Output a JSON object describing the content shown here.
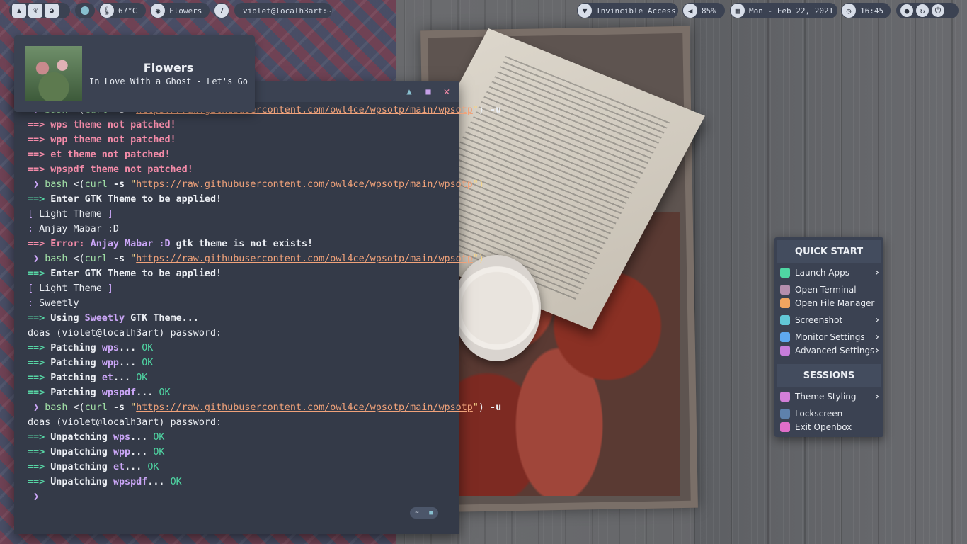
{
  "topbar": {
    "temperature": "67°C",
    "song": "Flowers",
    "workspace": "7",
    "terminal_title": "violet@localh3art:~",
    "network": "Invincible Access",
    "volume": "85%",
    "date": "Mon - Feb 22, 2021",
    "time": "16:45"
  },
  "music": {
    "title": "Flowers",
    "artist": "In Love With a Ghost - Let's Go"
  },
  "terminal": {
    "lines": [
      [
        {
          "t": " ❯ ",
          "c": "vi b"
        },
        {
          "t": "bash ",
          "c": "g"
        },
        {
          "t": "<(",
          "c": ""
        },
        {
          "t": "curl",
          "c": "g"
        },
        {
          "t": " -s ",
          "c": "b"
        },
        {
          "t": "\"",
          "c": "yel"
        },
        {
          "t": "https://raw.githubusercontent.com/owl4ce/wpsotp/main/wpsotp",
          "c": "url"
        },
        {
          "t": "\"",
          "c": "yel"
        },
        {
          "t": ") ",
          "c": ""
        },
        {
          "t": "-u",
          "c": "b"
        }
      ],
      [
        {
          "t": "==> ",
          "c": "pk b"
        },
        {
          "t": "wps theme not patched!",
          "c": "pk b"
        }
      ],
      [
        {
          "t": "==> ",
          "c": "pk b"
        },
        {
          "t": "wpp theme not patched!",
          "c": "pk b"
        }
      ],
      [
        {
          "t": "==> ",
          "c": "pk b"
        },
        {
          "t": "et theme not patched!",
          "c": "pk b"
        }
      ],
      [
        {
          "t": "==> ",
          "c": "pk b"
        },
        {
          "t": "wpspdf theme not patched!",
          "c": "pk b"
        }
      ],
      [
        {
          "t": " ❯ ",
          "c": "vi b"
        },
        {
          "t": "bash ",
          "c": "g"
        },
        {
          "t": "<(",
          "c": ""
        },
        {
          "t": "curl",
          "c": "g"
        },
        {
          "t": " -s ",
          "c": "b"
        },
        {
          "t": "\"",
          "c": "yel"
        },
        {
          "t": "https://raw.githubusercontent.com/owl4ce/wpsotp/main/wpsotp",
          "c": "url"
        },
        {
          "t": "\")",
          "c": "yel"
        }
      ],
      [
        {
          "t": "==> ",
          "c": "gb b"
        },
        {
          "t": "Enter GTK Theme to be applied!",
          "c": "b"
        }
      ],
      [
        {
          "t": "[ ",
          "c": "vi"
        },
        {
          "t": "Light Theme",
          "c": ""
        },
        {
          "t": " ]",
          "c": "vi"
        }
      ],
      [
        {
          "t": ": ",
          "c": "vi"
        },
        {
          "t": "Anjay Mabar :D",
          "c": ""
        }
      ],
      [
        {
          "t": "==> ",
          "c": "pk b"
        },
        {
          "t": "Error: ",
          "c": "pk b"
        },
        {
          "t": "Anjay Mabar :D ",
          "c": "vi b"
        },
        {
          "t": "gtk theme is not exists!",
          "c": "b"
        }
      ],
      [
        {
          "t": " ❯ ",
          "c": "vi b"
        },
        {
          "t": "bash ",
          "c": "g"
        },
        {
          "t": "<(",
          "c": ""
        },
        {
          "t": "curl",
          "c": "g"
        },
        {
          "t": " -s ",
          "c": "b"
        },
        {
          "t": "\"",
          "c": "yel"
        },
        {
          "t": "https://raw.githubusercontent.com/owl4ce/wpsotp/main/wpsotp",
          "c": "url"
        },
        {
          "t": "\")",
          "c": "yel"
        }
      ],
      [
        {
          "t": "==> ",
          "c": "gb b"
        },
        {
          "t": "Enter GTK Theme to be applied!",
          "c": "b"
        }
      ],
      [
        {
          "t": "[ ",
          "c": "vi"
        },
        {
          "t": "Light Theme",
          "c": ""
        },
        {
          "t": " ]",
          "c": "vi"
        }
      ],
      [
        {
          "t": ": ",
          "c": "vi"
        },
        {
          "t": "Sweetly",
          "c": ""
        }
      ],
      [
        {
          "t": "==> ",
          "c": "gb b"
        },
        {
          "t": "Using ",
          "c": "b"
        },
        {
          "t": "Sweetly ",
          "c": "vi b"
        },
        {
          "t": "GTK Theme...",
          "c": "b"
        }
      ],
      [
        {
          "t": "doas (violet@localh3art) password:",
          "c": ""
        }
      ],
      [
        {
          "t": "==> ",
          "c": "gb b"
        },
        {
          "t": "Patching ",
          "c": "b"
        },
        {
          "t": "wps",
          "c": "vi b"
        },
        {
          "t": "... ",
          "c": "b"
        },
        {
          "t": "OK",
          "c": "ok"
        }
      ],
      [
        {
          "t": "==> ",
          "c": "gb b"
        },
        {
          "t": "Patching ",
          "c": "b"
        },
        {
          "t": "wpp",
          "c": "vi b"
        },
        {
          "t": "... ",
          "c": "b"
        },
        {
          "t": "OK",
          "c": "ok"
        }
      ],
      [
        {
          "t": "==> ",
          "c": "gb b"
        },
        {
          "t": "Patching ",
          "c": "b"
        },
        {
          "t": "et",
          "c": "vi b"
        },
        {
          "t": "... ",
          "c": "b"
        },
        {
          "t": "OK",
          "c": "ok"
        }
      ],
      [
        {
          "t": "==> ",
          "c": "gb b"
        },
        {
          "t": "Patching ",
          "c": "b"
        },
        {
          "t": "wpspdf",
          "c": "vi b"
        },
        {
          "t": "... ",
          "c": "b"
        },
        {
          "t": "OK",
          "c": "ok"
        }
      ],
      [
        {
          "t": " ❯ ",
          "c": "vi b"
        },
        {
          "t": "bash ",
          "c": "g"
        },
        {
          "t": "<(",
          "c": ""
        },
        {
          "t": "curl",
          "c": "g"
        },
        {
          "t": " -s ",
          "c": "b"
        },
        {
          "t": "\"",
          "c": "yel"
        },
        {
          "t": "https://raw.githubusercontent.com/owl4ce/wpsotp/main/wpsotp",
          "c": "url"
        },
        {
          "t": "\"",
          "c": "yel"
        },
        {
          "t": ") ",
          "c": ""
        },
        {
          "t": "-u",
          "c": "b"
        }
      ],
      [
        {
          "t": "doas (violet@localh3art) password:",
          "c": ""
        }
      ],
      [
        {
          "t": "==> ",
          "c": "gb b"
        },
        {
          "t": "Unpatching ",
          "c": "b"
        },
        {
          "t": "wps",
          "c": "vi b"
        },
        {
          "t": "... ",
          "c": "b"
        },
        {
          "t": "OK",
          "c": "ok"
        }
      ],
      [
        {
          "t": "==> ",
          "c": "gb b"
        },
        {
          "t": "Unpatching ",
          "c": "b"
        },
        {
          "t": "wpp",
          "c": "vi b"
        },
        {
          "t": "... ",
          "c": "b"
        },
        {
          "t": "OK",
          "c": "ok"
        }
      ],
      [
        {
          "t": "==> ",
          "c": "gb b"
        },
        {
          "t": "Unpatching ",
          "c": "b"
        },
        {
          "t": "et",
          "c": "vi b"
        },
        {
          "t": "... ",
          "c": "b"
        },
        {
          "t": "OK",
          "c": "ok"
        }
      ],
      [
        {
          "t": "==> ",
          "c": "gb b"
        },
        {
          "t": "Unpatching ",
          "c": "b"
        },
        {
          "t": "wpspdf",
          "c": "vi b"
        },
        {
          "t": "... ",
          "c": "b"
        },
        {
          "t": "OK",
          "c": "ok"
        }
      ],
      [
        {
          "t": " ❯",
          "c": "vi b"
        }
      ]
    ],
    "chips": [
      "~",
      "■"
    ]
  },
  "menu": {
    "quick_start": "QUICK START",
    "items": [
      {
        "label": "Launch Apps",
        "color": "#4fd6a3",
        "arrow": true
      },
      {
        "label": "Open Terminal",
        "color": "#b48ead",
        "arrow": false
      },
      {
        "label": "Open File Manager",
        "color": "#f0a460",
        "arrow": false
      },
      {
        "label": "Screenshot",
        "color": "#62c7d6",
        "arrow": true
      },
      {
        "label": "Monitor Settings",
        "color": "#5fa8f0",
        "arrow": true
      },
      {
        "label": "Advanced Settings",
        "color": "#c77ddb",
        "arrow": true
      }
    ],
    "sessions": "SESSIONS",
    "session_items": [
      {
        "label": "Theme Styling",
        "color": "#d27fd8",
        "arrow": true
      },
      {
        "label": "Lockscreen",
        "color": "#5e81ac",
        "arrow": false
      },
      {
        "label": "Exit Openbox",
        "color": "#e06ec9",
        "arrow": false
      }
    ]
  }
}
